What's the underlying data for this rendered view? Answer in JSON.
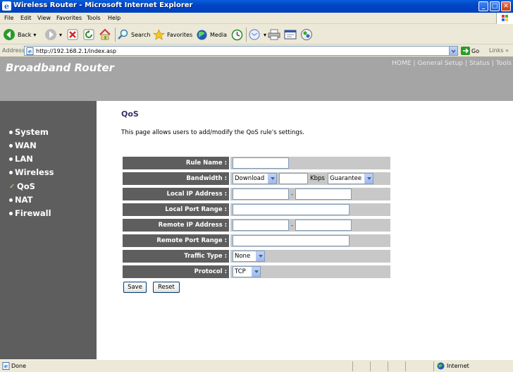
{
  "window": {
    "title": "Wireless Router - Microsoft Internet Explorer"
  },
  "menu": [
    "File",
    "Edit",
    "View",
    "Favorites",
    "Tools",
    "Help"
  ],
  "toolbar": {
    "back": "Back",
    "search": "Search",
    "favorites": "Favorites",
    "media": "Media"
  },
  "address": {
    "label": "Address",
    "url": "http://192.168.2.1/index.asp",
    "go": "Go",
    "links": "Links"
  },
  "header": {
    "brand": "Broadband Router",
    "nav": [
      "HOME",
      "General Setup",
      "Status",
      "Tools"
    ]
  },
  "sidebar": {
    "items": [
      {
        "label": "System",
        "active": false
      },
      {
        "label": "WAN",
        "active": false
      },
      {
        "label": "LAN",
        "active": false
      },
      {
        "label": "Wireless",
        "active": false
      },
      {
        "label": "QoS",
        "active": true
      },
      {
        "label": "NAT",
        "active": false
      },
      {
        "label": "Firewall",
        "active": false
      }
    ]
  },
  "page": {
    "title": "QoS",
    "description": "This page allows users to add/modify the QoS rule's settings."
  },
  "form": {
    "rule_name": {
      "label": "Rule Name :",
      "value": ""
    },
    "bandwidth": {
      "label": "Bandwidth :",
      "direction": "Download",
      "value": "",
      "unit": "Kbps",
      "mode": "Guarantee"
    },
    "local_ip": {
      "label": "Local IP Address :",
      "start": "",
      "sep": "-",
      "end": ""
    },
    "local_port": {
      "label": "Local Port Range :",
      "value": ""
    },
    "remote_ip": {
      "label": "Remote IP Address :",
      "start": "",
      "sep": "-",
      "end": ""
    },
    "remote_port": {
      "label": "Remote Port Range :",
      "value": ""
    },
    "traffic_type": {
      "label": "Traffic Type :",
      "value": "None"
    },
    "protocol": {
      "label": "Protocol :",
      "value": "TCP"
    }
  },
  "buttons": {
    "save": "Save",
    "reset": "Reset"
  },
  "status": {
    "text": "Done",
    "zone": "Internet"
  }
}
